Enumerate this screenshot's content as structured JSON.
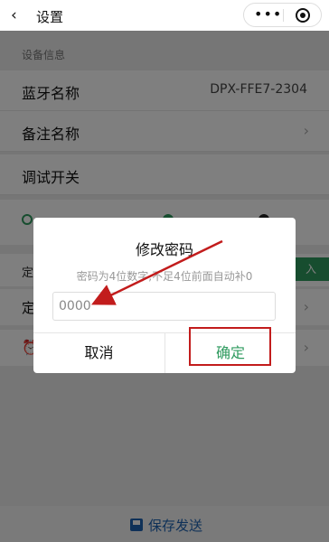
{
  "nav": {
    "back": "‹",
    "title": "设置",
    "more": "•••"
  },
  "section": {
    "device_info": "设备信息"
  },
  "rows": {
    "bluetooth_name_label": "蓝牙名称",
    "bluetooth_name_value": "DPX-FFE7-2304",
    "note_name_label": "备注名称",
    "debug_switch_label": "调试开关"
  },
  "background_fragments": {
    "row_a": "定",
    "row_b": "定",
    "row_a_btn": "入"
  },
  "dialog": {
    "title": "修改密码",
    "hint": "密码为4位数字,不足4位前面自动补0",
    "input_placeholder": "0000",
    "cancel": "取消",
    "confirm": "确定"
  },
  "bottom": {
    "save_send": "保存发送"
  },
  "colors": {
    "accent_green": "#2e9a5e",
    "accent_blue": "#1e62b0",
    "annotation_red": "#c21c1c"
  }
}
